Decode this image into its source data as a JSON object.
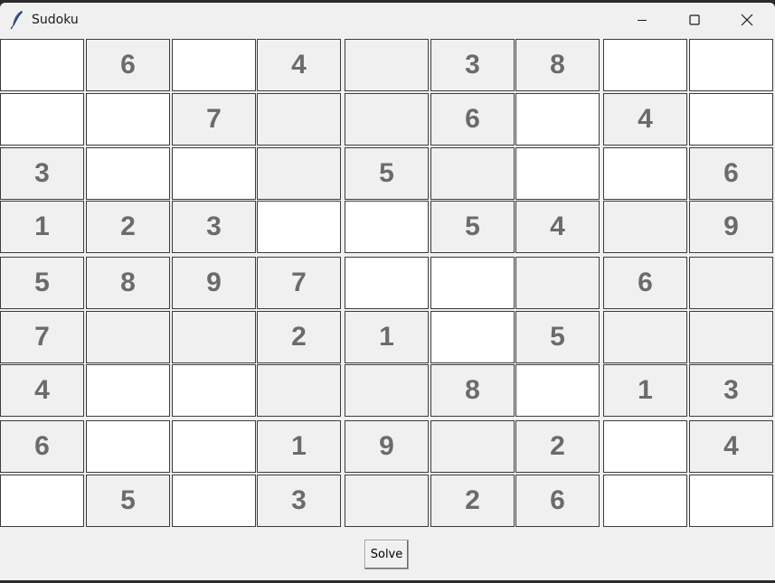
{
  "window": {
    "title": "Sudoku"
  },
  "colors": {
    "given_bg": "#f0f0f0",
    "empty_bg": "#ffffff",
    "digit": "#6b6b6b"
  },
  "board": [
    [
      "",
      "6",
      "",
      "4",
      "",
      "3",
      "8",
      "",
      ""
    ],
    [
      "",
      "",
      "7",
      "",
      "",
      "6",
      "",
      "4",
      ""
    ],
    [
      "3",
      "",
      "",
      "",
      "5",
      "",
      "",
      "",
      "6"
    ],
    [
      "1",
      "2",
      "3",
      "",
      "",
      "5",
      "4",
      "",
      "9"
    ],
    [
      "5",
      "8",
      "9",
      "7",
      "",
      "",
      "",
      "6",
      ""
    ],
    [
      "7",
      "",
      "",
      "2",
      "1",
      "",
      "5",
      "",
      ""
    ],
    [
      "4",
      "",
      "",
      "",
      "",
      "8",
      "",
      "1",
      "3"
    ],
    [
      "6",
      "",
      "",
      "1",
      "9",
      "",
      "2",
      "",
      "4"
    ],
    [
      "",
      "5",
      "",
      "3",
      "",
      "2",
      "6",
      "",
      ""
    ]
  ],
  "cell_shading": [
    [
      "w",
      "g",
      "w",
      "g",
      "g",
      "g",
      "g",
      "w",
      "w"
    ],
    [
      "w",
      "w",
      "g",
      "g",
      "g",
      "g",
      "w",
      "g",
      "w"
    ],
    [
      "g",
      "w",
      "w",
      "g",
      "g",
      "g",
      "w",
      "w",
      "g"
    ],
    [
      "g",
      "g",
      "g",
      "w",
      "w",
      "g",
      "g",
      "g",
      "g"
    ],
    [
      "g",
      "g",
      "g",
      "g",
      "w",
      "w",
      "g",
      "g",
      "g"
    ],
    [
      "g",
      "g",
      "g",
      "g",
      "g",
      "w",
      "g",
      "g",
      "g"
    ],
    [
      "g",
      "w",
      "w",
      "g",
      "g",
      "g",
      "w",
      "g",
      "g"
    ],
    [
      "g",
      "w",
      "w",
      "g",
      "g",
      "g",
      "g",
      "w",
      "g"
    ],
    [
      "w",
      "g",
      "w",
      "g",
      "g",
      "g",
      "g",
      "w",
      "w"
    ]
  ],
  "solve_button": {
    "label": "Solve"
  }
}
